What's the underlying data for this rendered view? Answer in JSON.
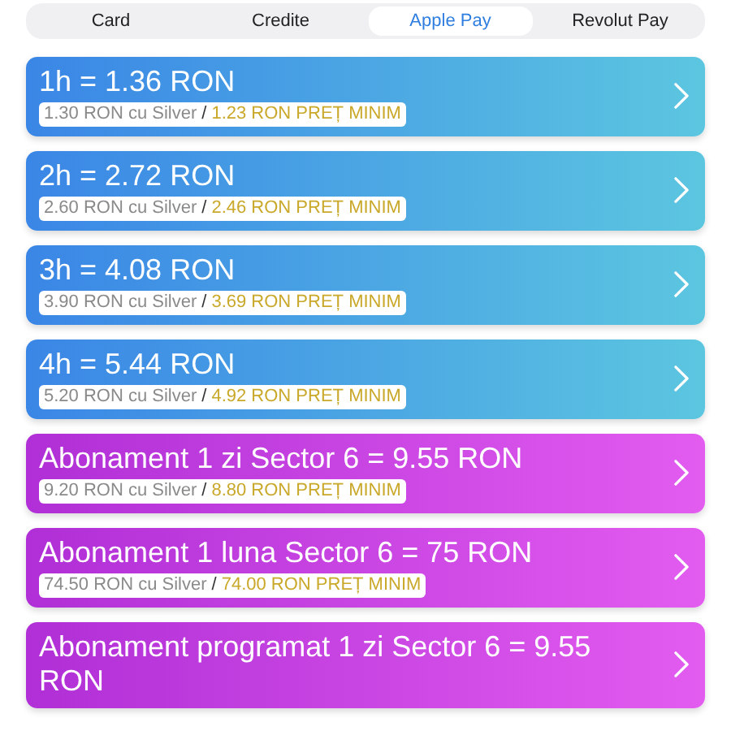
{
  "tabs": [
    {
      "label": "Card",
      "selected": false
    },
    {
      "label": "Credite",
      "selected": false
    },
    {
      "label": "Apple Pay",
      "selected": true
    },
    {
      "label": "Revolut Pay",
      "selected": false
    }
  ],
  "options": [
    {
      "kind": "hourly",
      "title": "1h = 1.36 RON",
      "silver": "1.30 RON cu Silver",
      "separator": "/",
      "minimum": "1.23 RON PREȚ MINIM"
    },
    {
      "kind": "hourly",
      "title": "2h = 2.72 RON",
      "silver": "2.60 RON cu Silver",
      "separator": "/",
      "minimum": "2.46 RON PREȚ MINIM"
    },
    {
      "kind": "hourly",
      "title": "3h = 4.08 RON",
      "silver": "3.90 RON cu Silver",
      "separator": "/",
      "minimum": "3.69 RON PREȚ MINIM"
    },
    {
      "kind": "hourly",
      "title": "4h = 5.44 RON",
      "silver": "5.20 RON cu Silver",
      "separator": "/",
      "minimum": "4.92 RON PREȚ MINIM"
    },
    {
      "kind": "subscription",
      "title": "Abonament 1 zi Sector 6 = 9.55 RON",
      "silver": "9.20 RON cu Silver",
      "separator": "/",
      "minimum": "8.80 RON PREȚ MINIM"
    },
    {
      "kind": "subscription",
      "title": "Abonament 1 luna Sector 6 = 75 RON",
      "silver": "74.50 RON cu Silver",
      "separator": "/",
      "minimum": "74.00 RON PREȚ MINIM"
    },
    {
      "kind": "subscription",
      "title": "Abonament programat 1 zi Sector 6 = 9.55 RON"
    }
  ]
}
